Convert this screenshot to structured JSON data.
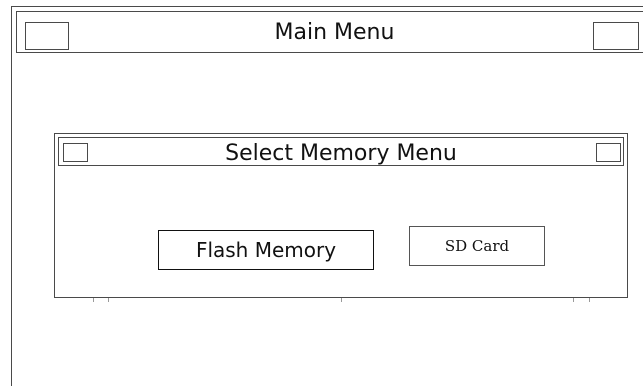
{
  "main_window": {
    "title": "Main Menu"
  },
  "dialog": {
    "title": "Select Memory Menu",
    "buttons": {
      "flash_memory": "Flash Memory",
      "sd_card": "SD Card"
    }
  }
}
